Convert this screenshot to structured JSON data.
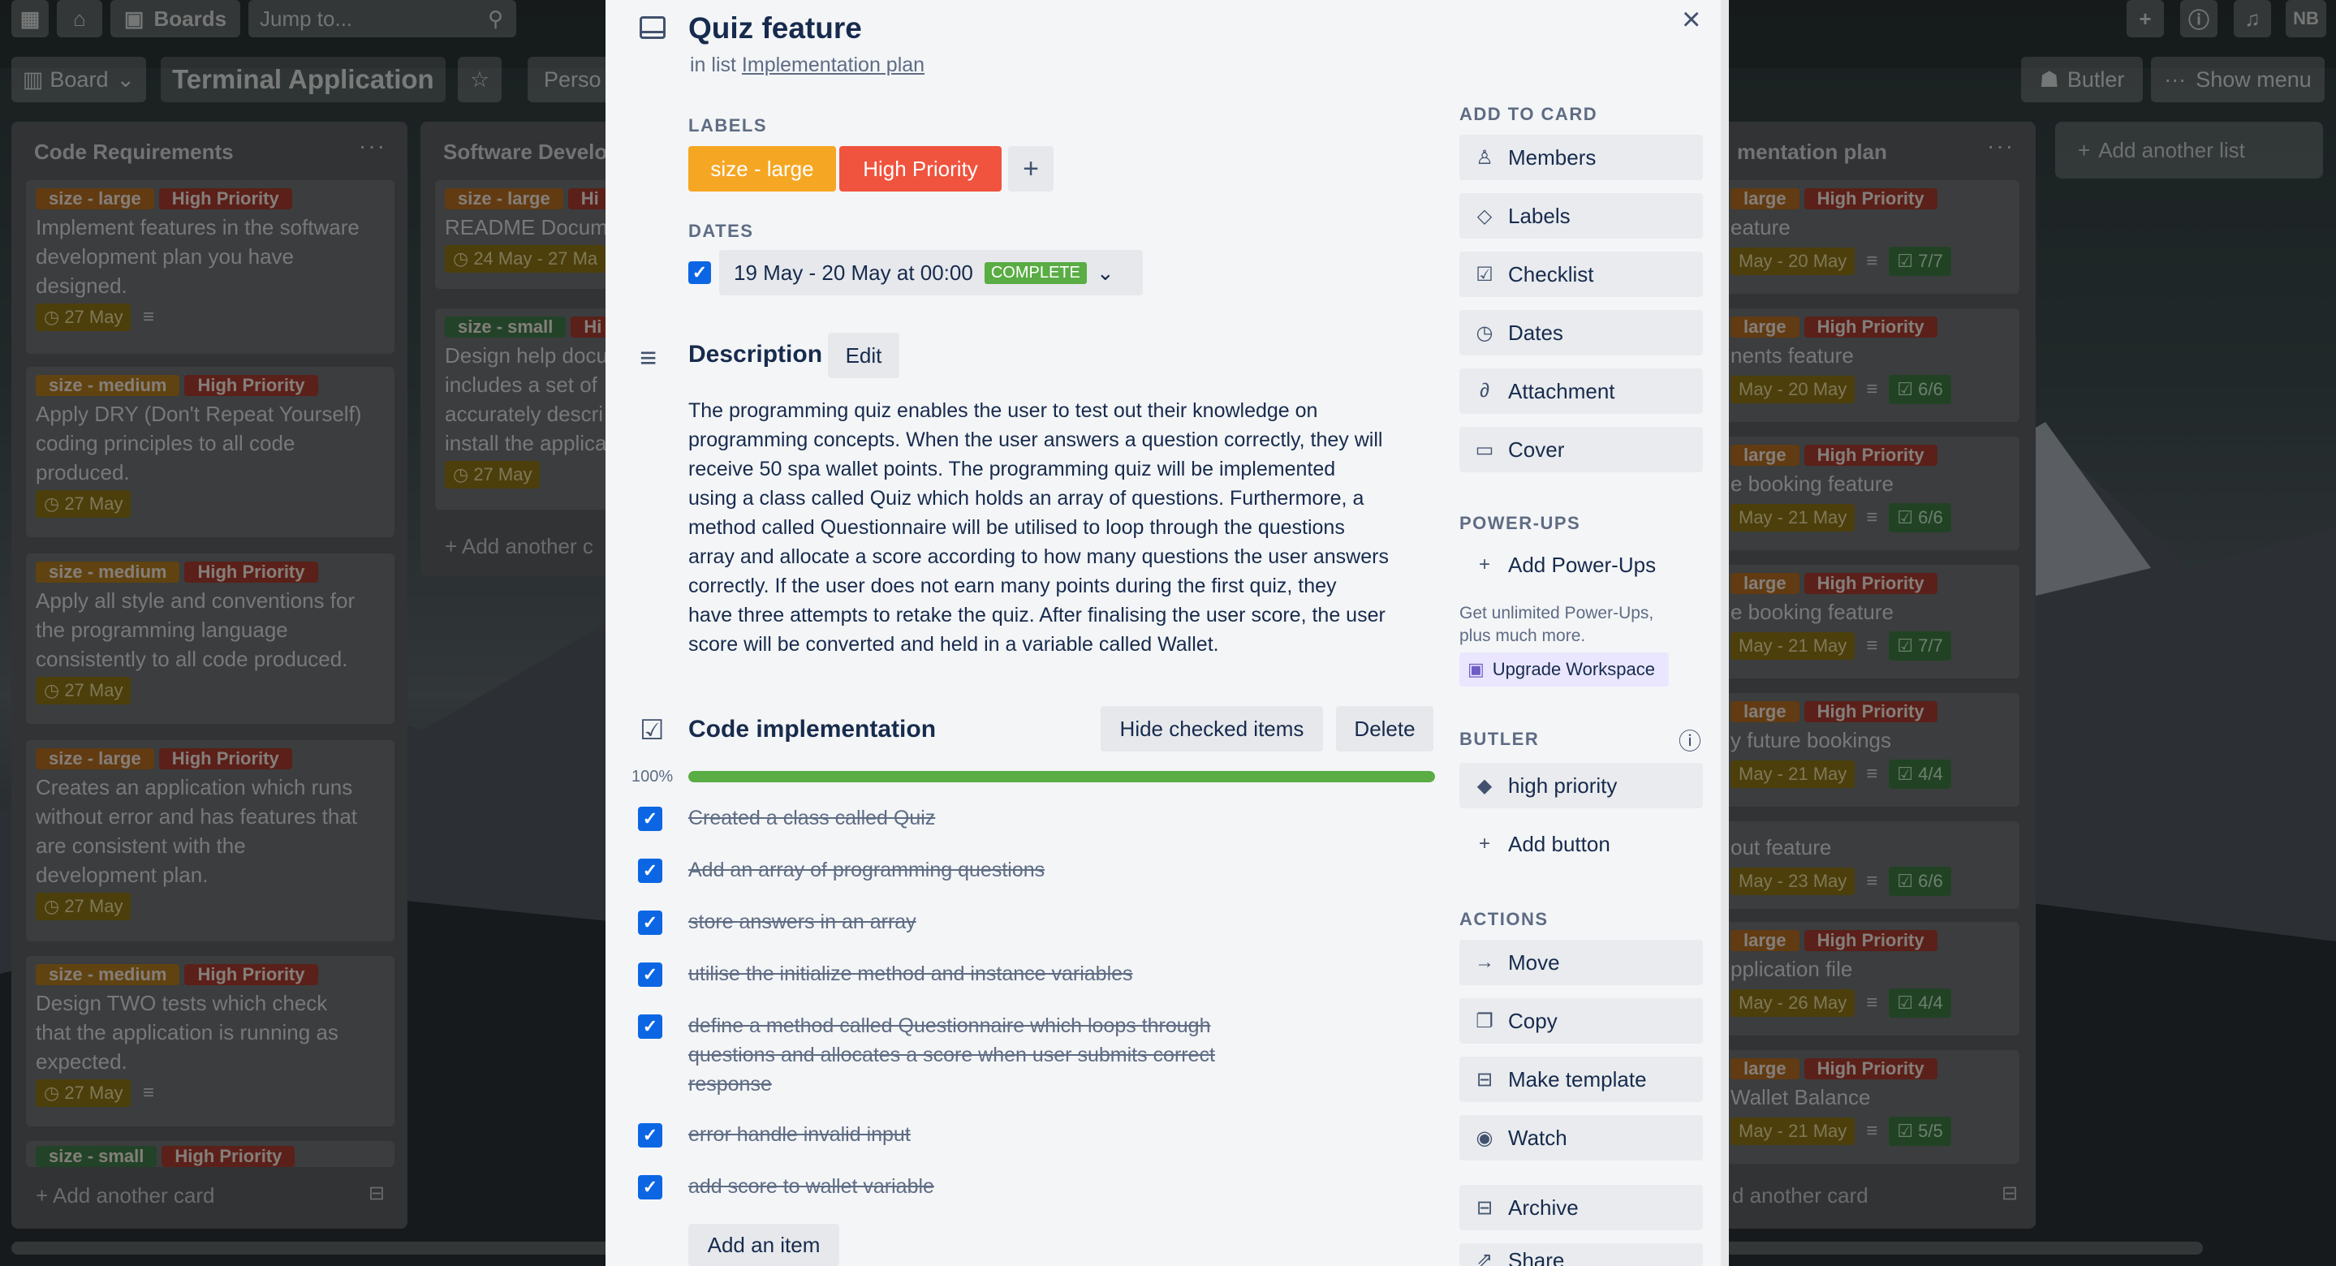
{
  "topbar": {
    "boards_label": "Boards",
    "search_placeholder": "Jump to...",
    "user_initials": "NB"
  },
  "boardbar": {
    "board_view_label": "Board",
    "board_title": "Terminal Application",
    "workspace_label": "Perso",
    "butler_label": "Butler",
    "show_menu_label": "Show menu"
  },
  "lists": [
    {
      "title": "Code Requirements",
      "cards": [
        {
          "labels": [
            "size - large",
            "High Priority"
          ],
          "text": [
            "Implement features in the software",
            "development plan you have",
            "designed."
          ],
          "due": "27 May"
        },
        {
          "labels": [
            "size - medium",
            "High Priority"
          ],
          "text": [
            "Apply DRY (Don't Repeat Yourself)",
            "coding principles to all code",
            "produced."
          ],
          "due": "27 May"
        },
        {
          "labels": [
            "size - medium",
            "High Priority"
          ],
          "text": [
            "Apply all style and conventions for",
            "the programming language",
            "consistently to all code produced."
          ],
          "due": "27 May"
        },
        {
          "labels": [
            "size - large",
            "High Priority"
          ],
          "text": [
            "Creates an application which runs",
            "without error and has features that",
            "are consistent with the",
            "development plan."
          ],
          "due": "27 May"
        },
        {
          "labels": [
            "size - medium",
            "High Priority"
          ],
          "text": [
            "Design TWO tests which check",
            "that the application is running as",
            "expected."
          ],
          "due": "27 May"
        },
        {
          "labels": [
            "size - small",
            "High Priority"
          ],
          "text": [],
          "due": ""
        }
      ],
      "add_card": "Add another card"
    },
    {
      "title": "Software Develo",
      "cards": [
        {
          "labels": [
            "size - large",
            "Hi"
          ],
          "text": [
            "README Docume"
          ],
          "due": "24 May - 27 Ma"
        },
        {
          "labels": [
            "size - small",
            "Hi"
          ],
          "text": [
            "Design help docu",
            "includes a set of",
            "accurately descri",
            "install the applica"
          ],
          "due": "27 May"
        }
      ],
      "add_card": "Add another c"
    },
    {
      "title": "mentation plan",
      "cards": [
        {
          "labels": [
            "large",
            "High Priority"
          ],
          "text": "eature",
          "due": "May - 20 May",
          "check": "7/7"
        },
        {
          "labels": [
            "large",
            "High Priority"
          ],
          "text": "nents feature",
          "due": "May - 20 May",
          "check": "6/6"
        },
        {
          "labels": [
            "large",
            "High Priority"
          ],
          "text": "e booking feature",
          "due": "May - 21 May",
          "check": "6/6"
        },
        {
          "labels": [
            "large",
            "High Priority"
          ],
          "text": "e booking feature",
          "due": "May - 21 May",
          "check": "7/7"
        },
        {
          "labels": [
            "large",
            "High Priority"
          ],
          "text": "y future bookings",
          "due": "May - 21 May",
          "check": "4/4"
        },
        {
          "labels": [],
          "text": "out feature",
          "due": "May - 23 May",
          "check": "6/6"
        },
        {
          "labels": [
            "large",
            "High Priority"
          ],
          "text": "pplication file",
          "due": "May - 26 May",
          "check": "4/4"
        },
        {
          "labels": [
            "large",
            "High Priority"
          ],
          "text": "Wallet Balance",
          "due": "May - 21 May",
          "check": "5/5"
        }
      ],
      "add_card": "d another card"
    }
  ],
  "add_list": "Add another list",
  "modal": {
    "title": "Quiz feature",
    "in_list_prefix": "in list",
    "in_list_name": "Implementation plan",
    "labels_heading": "LABELS",
    "labels": [
      {
        "text": "size - large",
        "color": "#f5a623"
      },
      {
        "text": "High Priority",
        "color": "#f0533e"
      }
    ],
    "dates_heading": "DATES",
    "dates_value": "19 May - 20 May at 00:00",
    "dates_status": "COMPLETE",
    "description_heading": "Description",
    "description_edit": "Edit",
    "description_lines": [
      "The programming quiz enables the user to test out their knowledge on",
      "programming concepts. When the user answers a question correctly, they will",
      "receive 50 spa wallet points. The programming quiz will be implemented",
      "using a class called Quiz which holds an array of questions. Furthermore, a",
      "method called Questionnaire will be utilised to loop through the questions",
      "array and allocate a score according to how many questions the user answers",
      "correctly. If the user does not earn many points during the first quiz, they",
      "have three attempts to retake the quiz. After finalising the user score, the user",
      "score will be converted and held in a variable called Wallet."
    ],
    "checklist": {
      "title": "Code implementation",
      "hide_checked": "Hide checked items",
      "delete": "Delete",
      "progress_label": "100%",
      "progress": 1.0,
      "items": [
        [
          "Created a class called Quiz"
        ],
        [
          "Add an array of programming questions"
        ],
        [
          "store answers in an array"
        ],
        [
          "utilise the initialize method and instance variables"
        ],
        [
          "define a method called Questionnaire which loops through",
          "questions and allocates a score when user submits correct",
          "response"
        ],
        [
          "error handle invalid input"
        ],
        [
          "add score to wallet variable"
        ]
      ],
      "add_item": "Add an item"
    },
    "sidebar": {
      "add_to_card_heading": "ADD TO CARD",
      "add_to_card": [
        {
          "label": "Members",
          "icon": "person-icon"
        },
        {
          "label": "Labels",
          "icon": "tag-icon"
        },
        {
          "label": "Checklist",
          "icon": "checklist-icon"
        },
        {
          "label": "Dates",
          "icon": "clock-icon"
        },
        {
          "label": "Attachment",
          "icon": "paperclip-icon"
        },
        {
          "label": "Cover",
          "icon": "cover-icon"
        }
      ],
      "powerups_heading": "POWER-UPS",
      "add_powerups": "Add Power-Ups",
      "powerups_note": [
        "Get unlimited Power-Ups,",
        "plus much more."
      ],
      "upgrade": "Upgrade Workspace",
      "butler_heading": "BUTLER",
      "butler_buttons": [
        {
          "label": "high priority",
          "icon": "tag-icon"
        },
        {
          "label": "Add button",
          "icon": "plus-icon"
        }
      ],
      "actions_heading": "ACTIONS",
      "actions": [
        {
          "label": "Move",
          "icon": "arrow-right-icon"
        },
        {
          "label": "Copy",
          "icon": "copy-icon"
        },
        {
          "label": "Make template",
          "icon": "template-icon"
        },
        {
          "label": "Watch",
          "icon": "eye-icon"
        },
        {
          "label": "Archive",
          "icon": "archive-icon"
        },
        {
          "label": "Share",
          "icon": "share-icon"
        }
      ]
    }
  }
}
